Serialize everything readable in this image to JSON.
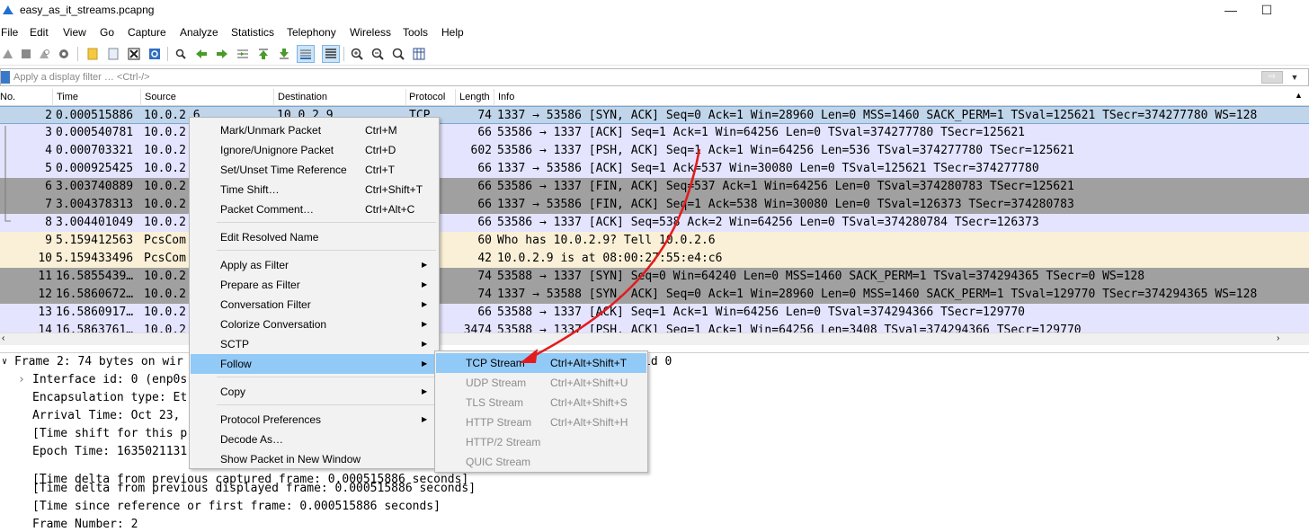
{
  "window": {
    "title": "easy_as_it_streams.pcapng",
    "minimize_glyph": "—",
    "maximize_glyph": "☐"
  },
  "menu": [
    "File",
    "Edit",
    "View",
    "Go",
    "Capture",
    "Analyze",
    "Statistics",
    "Telephony",
    "Wireless",
    "Tools",
    "Help"
  ],
  "toolbar_icons": [
    "shark-start-icon",
    "stop-icon",
    "restart-icon",
    "options-icon",
    "open-icon",
    "save-icon",
    "close-file-icon",
    "reload-icon",
    "find-icon",
    "back-icon",
    "forward-icon",
    "go-to-packet-icon",
    "first-packet-icon",
    "last-packet-icon",
    "auto-scroll-icon",
    "colorize-icon",
    "zoom-in-icon",
    "zoom-out-icon",
    "normal-size-icon",
    "resize-columns-icon"
  ],
  "filter": {
    "placeholder": "Apply a display filter … <Ctrl-/>"
  },
  "columns": {
    "no": "No.",
    "time": "Time",
    "source": "Source",
    "destination": "Destination",
    "protocol": "Protocol",
    "length": "Length",
    "info": "Info"
  },
  "colors": {
    "tcp": "#e4e4fe",
    "tcp_selected": "#c0d5ea",
    "tcp_fin_syn": "#a0a0a0",
    "arp": "#faf0d7",
    "menu_highlight": "#91c9f7",
    "annotation_red": "#e21c1c"
  },
  "packets": [
    {
      "no": "2",
      "time": "0.000515886",
      "src": "10.0.2.6",
      "dst": "10.0.2.9",
      "proto": "TCP",
      "len": "74",
      "info": "1337 → 53586 [SYN, ACK] Seq=0 Ack=1 Win=28960 Len=0 MSS=1460 SACK_PERM=1 TSval=125621 TSecr=374277780 WS=128",
      "kind": "selected"
    },
    {
      "no": "3",
      "time": "0.000540781",
      "src": "10.0.2",
      "dst": "",
      "proto": "",
      "len": "66",
      "info": "53586 → 1337 [ACK] Seq=1 Ack=1 Win=64256 Len=0 TSval=374277780 TSecr=125621",
      "kind": "tcp"
    },
    {
      "no": "4",
      "time": "0.000703321",
      "src": "10.0.2",
      "dst": "",
      "proto": "",
      "len": "602",
      "info": "53586 → 1337 [PSH, ACK] Seq=1 Ack=1 Win=64256 Len=536 TSval=374277780 TSecr=125621",
      "kind": "tcp"
    },
    {
      "no": "5",
      "time": "0.000925425",
      "src": "10.0.2",
      "dst": "",
      "proto": "",
      "len": "66",
      "info": "1337 → 53586 [ACK] Seq=1 Ack=537 Win=30080 Len=0 TSval=125621 TSecr=374277780",
      "kind": "tcp"
    },
    {
      "no": "6",
      "time": "3.003740889",
      "src": "10.0.2",
      "dst": "",
      "proto": "",
      "len": "66",
      "info": "53586 → 1337 [FIN, ACK] Seq=537 Ack=1 Win=64256 Len=0 TSval=374280783 TSecr=125621",
      "kind": "dark"
    },
    {
      "no": "7",
      "time": "3.004378313",
      "src": "10.0.2",
      "dst": "",
      "proto": "",
      "len": "66",
      "info": "1337 → 53586 [FIN, ACK] Seq=1 Ack=538 Win=30080 Len=0 TSval=126373 TSecr=374280783",
      "kind": "dark"
    },
    {
      "no": "8",
      "time": "3.004401049",
      "src": "10.0.2",
      "dst": "",
      "proto": "",
      "len": "66",
      "info": "53586 → 1337 [ACK] Seq=538 Ack=2 Win=64256 Len=0 TSval=374280784 TSecr=126373",
      "kind": "tcp"
    },
    {
      "no": "9",
      "time": "5.159412563",
      "src": "PcsCom",
      "dst": "",
      "proto": "",
      "len": "60",
      "info": "Who has 10.0.2.9? Tell 10.0.2.6",
      "kind": "arp"
    },
    {
      "no": "10",
      "time": "5.159433496",
      "src": "PcsCom",
      "dst": "",
      "proto": "",
      "len": "42",
      "info": "10.0.2.9 is at 08:00:27:55:e4:c6",
      "kind": "arp"
    },
    {
      "no": "11",
      "time": "16.5855439…",
      "src": "10.0.2",
      "dst": "",
      "proto": "",
      "len": "74",
      "info": "53588 → 1337 [SYN] Seq=0 Win=64240 Len=0 MSS=1460 SACK_PERM=1 TSval=374294365 TSecr=0 WS=128",
      "kind": "dark"
    },
    {
      "no": "12",
      "time": "16.5860672…",
      "src": "10.0.2",
      "dst": "",
      "proto": "",
      "len": "74",
      "info": "1337 → 53588 [SYN, ACK] Seq=0 Ack=1 Win=28960 Len=0 MSS=1460 SACK_PERM=1 TSval=129770 TSecr=374294365 WS=128",
      "kind": "dark"
    },
    {
      "no": "13",
      "time": "16.5860917…",
      "src": "10.0.2",
      "dst": "",
      "proto": "",
      "len": "66",
      "info": "53588 → 1337 [ACK] Seq=1 Ack=1 Win=64256 Len=0 TSval=374294366 TSecr=129770",
      "kind": "tcp"
    },
    {
      "no": "14",
      "time": "16.5863761…",
      "src": "10.0.2",
      "dst": "",
      "proto": "",
      "len": "3474",
      "info": "53588 → 1337 [PSH, ACK] Seq=1 Ack=1 Win=64256 Len=3408 TSval=374294366 TSecr=129770",
      "kind": "tcp"
    }
  ],
  "details": [
    {
      "text": "Frame 2: 74 bytes on wir",
      "tail": "id 0",
      "indent": 0,
      "expander": "∨"
    },
    {
      "text": "Interface id: 0 (enp0s",
      "indent": 1,
      "expander": "›"
    },
    {
      "text": "Encapsulation type: Et",
      "indent": 1,
      "expander": ""
    },
    {
      "text": "Arrival Time: Oct 23, ",
      "indent": 1,
      "expander": ""
    },
    {
      "text": "[Time shift for this p",
      "indent": 1,
      "expander": ""
    },
    {
      "text": "Epoch Time: 1635021131",
      "indent": 1,
      "expander": ""
    },
    {
      "text": "[Time delta from previous captured frame: 0.000515886 seconds]",
      "indent": 1,
      "expander": ""
    },
    {
      "text": "[Time delta from previous displayed frame: 0.000515886 seconds]",
      "indent": 1,
      "expander": ""
    },
    {
      "text": "[Time since reference or first frame: 0.000515886 seconds]",
      "indent": 1,
      "expander": ""
    },
    {
      "text": "Frame Number: 2",
      "indent": 1,
      "expander": ""
    }
  ],
  "context_menu": [
    {
      "label": "Mark/Unmark Packet",
      "shortcut": "Ctrl+M"
    },
    {
      "label": "Ignore/Unignore Packet",
      "shortcut": "Ctrl+D"
    },
    {
      "label": "Set/Unset Time Reference",
      "shortcut": "Ctrl+T"
    },
    {
      "label": "Time Shift…",
      "shortcut": "Ctrl+Shift+T"
    },
    {
      "label": "Packet Comment…",
      "shortcut": "Ctrl+Alt+C"
    },
    {
      "label": "Edit Resolved Name",
      "shortcut": ""
    },
    {
      "label": "Apply as Filter",
      "shortcut": "",
      "submenu": true
    },
    {
      "label": "Prepare as Filter",
      "shortcut": "",
      "submenu": true
    },
    {
      "label": "Conversation Filter",
      "shortcut": "",
      "submenu": true
    },
    {
      "label": "Colorize Conversation",
      "shortcut": "",
      "submenu": true
    },
    {
      "label": "SCTP",
      "shortcut": "",
      "submenu": true
    },
    {
      "label": "Follow",
      "shortcut": "",
      "submenu": true,
      "highlighted": true
    },
    {
      "label": "Copy",
      "shortcut": "",
      "submenu": true
    },
    {
      "label": "Protocol Preferences",
      "shortcut": "",
      "submenu": true
    },
    {
      "label": "Decode As…",
      "shortcut": ""
    },
    {
      "label": "Show Packet in New Window",
      "shortcut": ""
    }
  ],
  "follow_submenu": [
    {
      "label": "TCP Stream",
      "shortcut": "Ctrl+Alt+Shift+T",
      "highlighted": true,
      "disabled": false
    },
    {
      "label": "UDP Stream",
      "shortcut": "Ctrl+Alt+Shift+U",
      "disabled": true
    },
    {
      "label": "TLS Stream",
      "shortcut": "Ctrl+Alt+Shift+S",
      "disabled": true
    },
    {
      "label": "HTTP Stream",
      "shortcut": "Ctrl+Alt+Shift+H",
      "disabled": true
    },
    {
      "label": "HTTP/2 Stream",
      "shortcut": "",
      "disabled": true
    },
    {
      "label": "QUIC Stream",
      "shortcut": "",
      "disabled": true
    }
  ]
}
